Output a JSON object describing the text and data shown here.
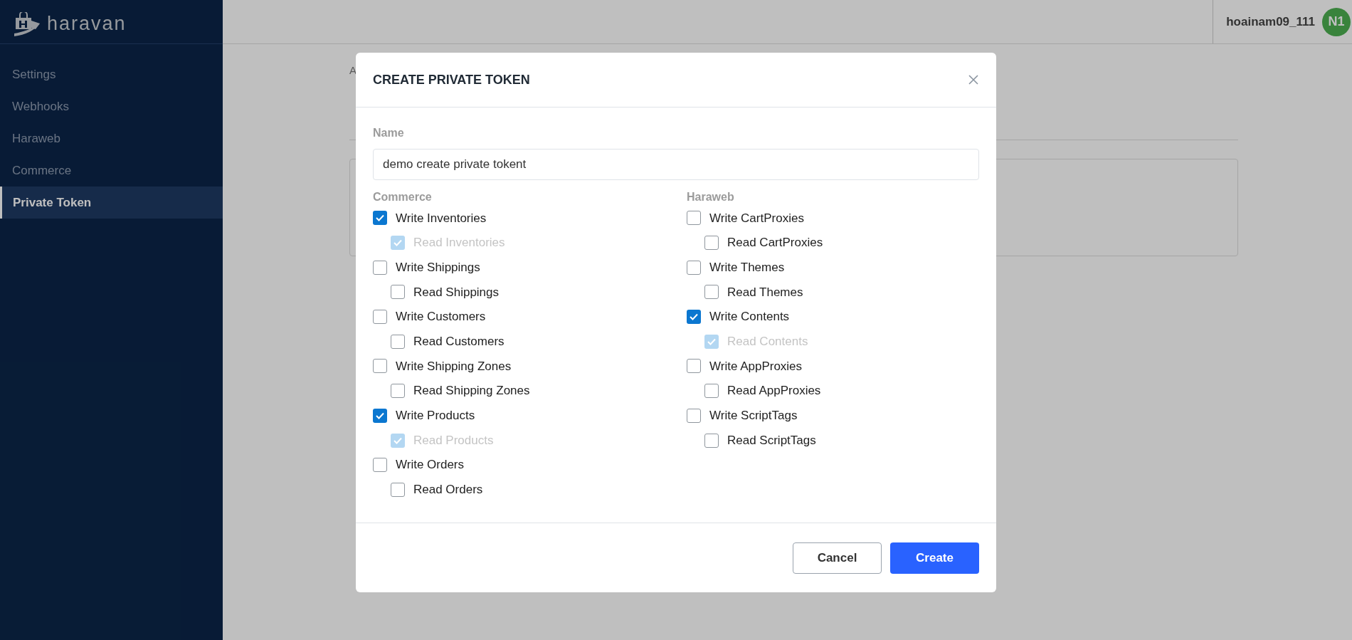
{
  "sidebar": {
    "logo": "haravan",
    "items": [
      {
        "label": "Settings",
        "selected": false
      },
      {
        "label": "Webhooks",
        "selected": false
      },
      {
        "label": "Haraweb",
        "selected": false
      },
      {
        "label": "Commerce",
        "selected": false
      },
      {
        "label": "Private Token",
        "selected": true
      }
    ]
  },
  "header": {
    "user": "hoainam09_111",
    "avatar": "N1"
  },
  "page": {
    "breadcrumb": "A"
  },
  "modal": {
    "title": "CREATE PRIVATE TOKEN",
    "name_label": "Name",
    "name_value": "demo create private tokent",
    "groups": [
      {
        "title": "Commerce",
        "permissions": [
          {
            "label": "Write Inventories",
            "checked": true,
            "children": [
              {
                "label": "Read Inventories",
                "checked": true,
                "disabled": true
              }
            ]
          },
          {
            "label": "Write Shippings",
            "checked": false,
            "children": [
              {
                "label": "Read Shippings",
                "checked": false,
                "disabled": false
              }
            ]
          },
          {
            "label": "Write Customers",
            "checked": false,
            "children": [
              {
                "label": "Read Customers",
                "checked": false,
                "disabled": false
              }
            ]
          },
          {
            "label": "Write Shipping Zones",
            "checked": false,
            "children": [
              {
                "label": "Read Shipping Zones",
                "checked": false,
                "disabled": false
              }
            ]
          },
          {
            "label": "Write Products",
            "checked": true,
            "children": [
              {
                "label": "Read Products",
                "checked": true,
                "disabled": true
              }
            ]
          },
          {
            "label": "Write Orders",
            "checked": false,
            "children": [
              {
                "label": "Read Orders",
                "checked": false,
                "disabled": false
              }
            ]
          }
        ]
      },
      {
        "title": "Haraweb",
        "permissions": [
          {
            "label": "Write CartProxies",
            "checked": false,
            "children": [
              {
                "label": "Read CartProxies",
                "checked": false,
                "disabled": false
              }
            ]
          },
          {
            "label": "Write Themes",
            "checked": false,
            "children": [
              {
                "label": "Read Themes",
                "checked": false,
                "disabled": false
              }
            ]
          },
          {
            "label": "Write Contents",
            "checked": true,
            "children": [
              {
                "label": "Read Contents",
                "checked": true,
                "disabled": true
              }
            ]
          },
          {
            "label": "Write AppProxies",
            "checked": false,
            "children": [
              {
                "label": "Read AppProxies",
                "checked": false,
                "disabled": false
              }
            ]
          },
          {
            "label": "Write ScriptTags",
            "checked": false,
            "children": [
              {
                "label": "Read ScriptTags",
                "checked": false,
                "disabled": false
              }
            ]
          }
        ]
      }
    ],
    "buttons": [
      {
        "label": "Cancel",
        "kind": "secondary"
      },
      {
        "label": "Create",
        "kind": "primary"
      }
    ]
  }
}
